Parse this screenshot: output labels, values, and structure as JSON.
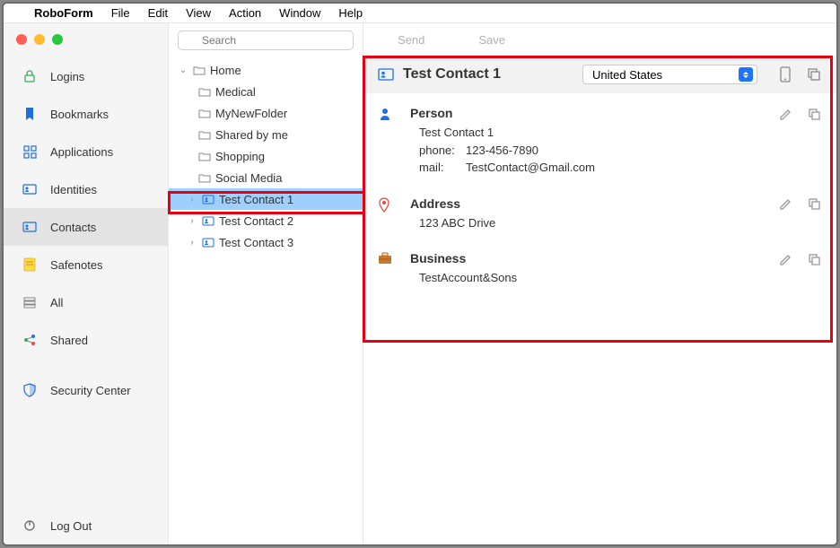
{
  "menubar": {
    "appname": "RoboForm",
    "items": [
      "File",
      "Edit",
      "View",
      "Action",
      "Window",
      "Help"
    ]
  },
  "sidebar": {
    "items": [
      {
        "label": "Logins",
        "icon": "lock"
      },
      {
        "label": "Bookmarks",
        "icon": "bookmark"
      },
      {
        "label": "Applications",
        "icon": "grid"
      },
      {
        "label": "Identities",
        "icon": "card"
      },
      {
        "label": "Contacts",
        "icon": "contact",
        "selected": true
      },
      {
        "label": "Safenotes",
        "icon": "note"
      },
      {
        "label": "All",
        "icon": "drawer"
      },
      {
        "label": "Shared",
        "icon": "share"
      },
      {
        "label": "Security Center",
        "icon": "shield"
      }
    ],
    "logout": "Log Out"
  },
  "search": {
    "placeholder": "Search"
  },
  "tree": {
    "root": "Home",
    "folders": [
      "Medical",
      "MyNewFolder",
      "Shared by me",
      "Shopping",
      "Social Media"
    ],
    "contacts": [
      {
        "label": "Test Contact 1",
        "selected": true
      },
      {
        "label": "Test Contact 2"
      },
      {
        "label": "Test Contact 3"
      }
    ]
  },
  "detailTop": {
    "send": "Send",
    "save": "Save"
  },
  "detailHeader": {
    "title": "Test Contact 1",
    "country": "United States"
  },
  "sections": {
    "person": {
      "title": "Person",
      "name": "Test Contact 1",
      "phoneLabel": "phone:",
      "phone": "123-456-7890",
      "mailLabel": "mail:",
      "mail": "TestContact@Gmail.com"
    },
    "address": {
      "title": "Address",
      "line": "123 ABC Drive"
    },
    "business": {
      "title": "Business",
      "line": "TestAccount&Sons"
    }
  }
}
